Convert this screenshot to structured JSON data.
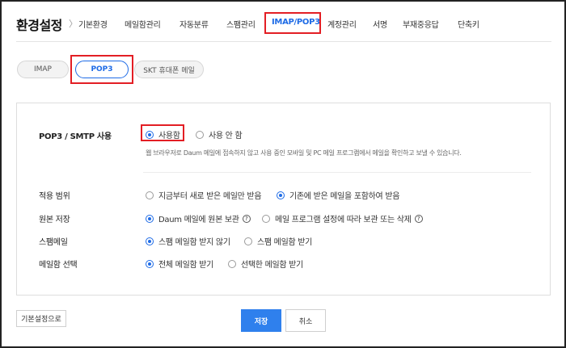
{
  "header": {
    "title": "환경설정",
    "separator": "〉",
    "tabs": [
      {
        "label": "기본환경",
        "active": false
      },
      {
        "label": "메일함관리",
        "active": false
      },
      {
        "label": "자동분류",
        "active": false
      },
      {
        "label": "스팸관리",
        "active": false
      },
      {
        "label": "IMAP/POP3",
        "active": true
      },
      {
        "label": "계정관리",
        "active": false
      },
      {
        "label": "서명",
        "active": false
      },
      {
        "label": "부재중응답",
        "active": false
      },
      {
        "label": "단축키",
        "active": false
      }
    ]
  },
  "subtabs": [
    {
      "label": "IMAP",
      "active": false
    },
    {
      "label": "POP3",
      "active": true
    },
    {
      "label": "SKT 휴대폰 메일",
      "active": false
    }
  ],
  "settings": {
    "pop3_smtp": {
      "label": "POP3 / SMTP 사용",
      "options": [
        "사용함",
        "사용 안 함"
      ],
      "selected": "사용함",
      "description": "웹 브라우저로 Daum 메일에 접속하지 않고 사용 중인 모바일 및 PC 메일 프로그램에서 메일을 확인하고 보낼 수 있습니다."
    },
    "apply_scope": {
      "label": "적용 범위",
      "options": [
        "지금부터 새로 받은 메일만 받음",
        "기존에 받은 메일을 포함하여 받음"
      ],
      "selected": "기존에 받은 메일을 포함하여 받음"
    },
    "original_save": {
      "label": "원본 저장",
      "options": [
        "Daum 메일에 원본 보관",
        "메일 프로그램 설정에 따라 보관 또는 삭제"
      ],
      "selected": "Daum 메일에 원본 보관",
      "help_icon": "?"
    },
    "spam_mail": {
      "label": "스팸메일",
      "options": [
        "스팸 메일함 받지 않기",
        "스팸 메일함 받기"
      ],
      "selected": "스팸 메일함 받지 않기"
    },
    "mailbox_select": {
      "label": "메일함 선택",
      "options": [
        "전체 메일함 받기",
        "선택한 메일함 받기"
      ],
      "selected": "전체 메일함 받기"
    }
  },
  "footer": {
    "reset_label": "기본설정으로",
    "save_label": "저장",
    "cancel_label": "취소"
  },
  "colors": {
    "accent": "#1e6be6",
    "save_button": "#2f80ed",
    "highlight": "#e31e24"
  }
}
